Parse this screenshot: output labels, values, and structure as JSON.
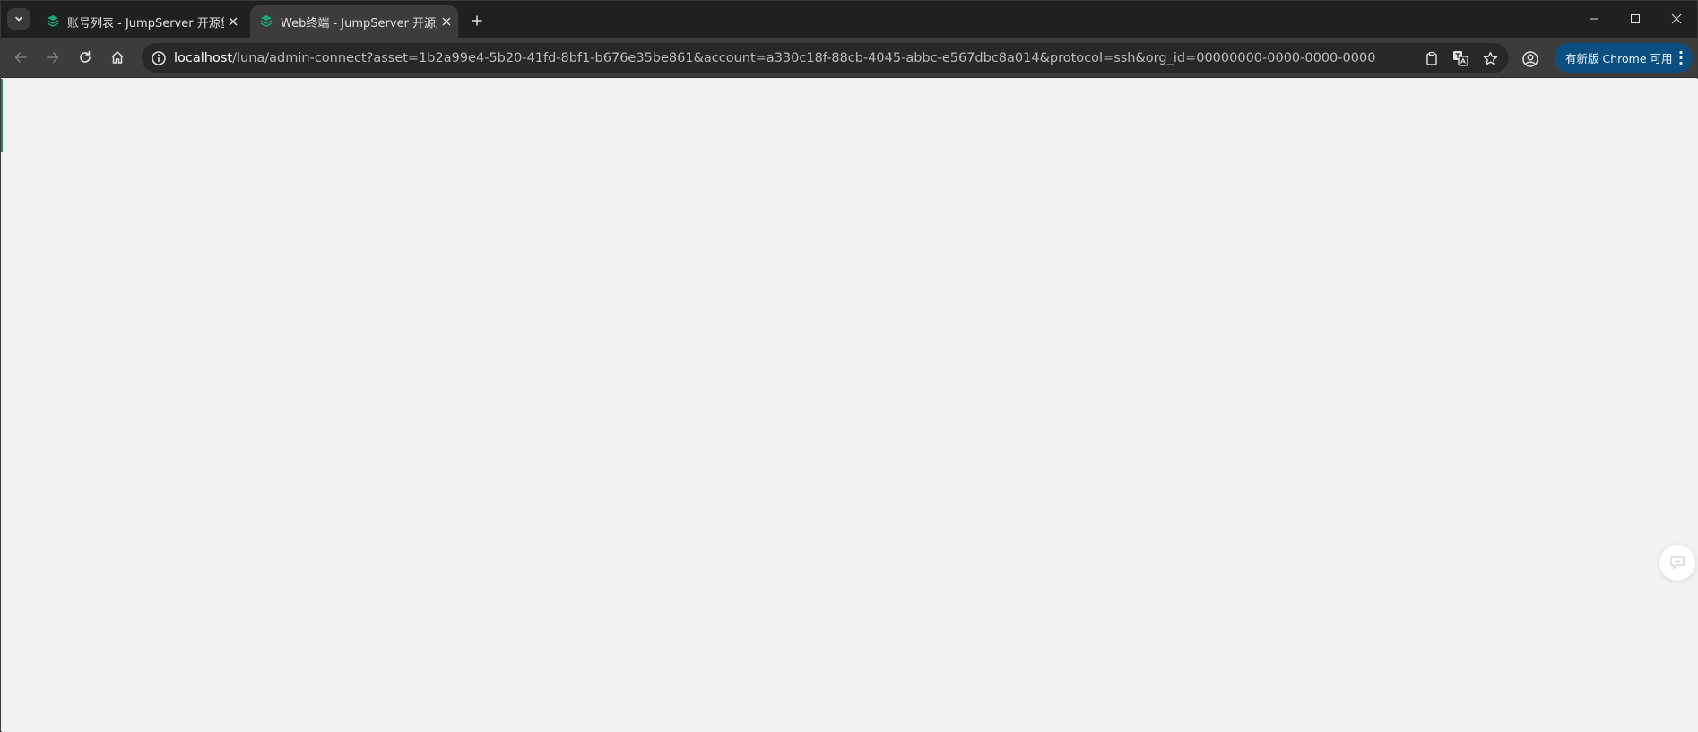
{
  "browser": {
    "tabs": [
      {
        "title": "账号列表 - JumpServer 开源堡垒机",
        "active": false,
        "favicon": "jumpserver-logo-icon"
      },
      {
        "title": "Web终端 - JumpServer 开源堡垒机",
        "active": true,
        "favicon": "jumpserver-logo-icon"
      }
    ],
    "omnibox": {
      "host": "localhost",
      "path": "/luna/admin-connect?asset=1b2a99e4-5b20-41fd-8bf1-b676e35be861&account=a330c18f-88cb-4045-abbc-e567dbc8a014&protocol=ssh&org_id=00000000-0000-0000-0000-000000000002"
    },
    "update_button": "有新版 Chrome 可用"
  },
  "colors": {
    "tab_strip": "#1f2020",
    "toolbar": "#3c3c3c",
    "omnibox": "#282828",
    "update_button": "#0b4f80",
    "content_bg": "#f2f2f2",
    "favicon": "#1aa87a"
  }
}
